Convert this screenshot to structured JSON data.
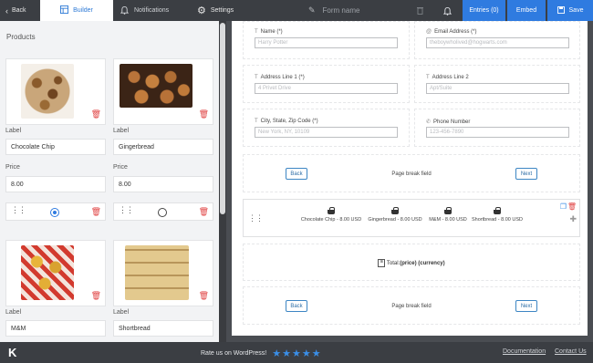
{
  "topbar": {
    "back": "Back",
    "builder": "Builder",
    "notifications": "Notifications",
    "settings": "Settings",
    "form_name": "Form name",
    "entries": "Entries (0)",
    "embed": "Embed",
    "save": "Save"
  },
  "products_panel": {
    "title": "Products",
    "label_caption": "Label",
    "price_caption": "Price",
    "products": [
      {
        "label": "Chocolate Chip",
        "price": "8.00",
        "selected": true
      },
      {
        "label": "Gingerbread",
        "price": "8.00",
        "selected": false
      },
      {
        "label": "M&M"
      },
      {
        "label": "Shortbread"
      }
    ]
  },
  "form": {
    "fields": {
      "name": {
        "label": "Name (*)",
        "placeholder": "Harry Potter"
      },
      "email": {
        "label": "Email Address (*)",
        "placeholder": "theboywholived@hogwarts.com"
      },
      "address1": {
        "label": "Address Line 1 (*)",
        "placeholder": "4 Privet Drive"
      },
      "address2": {
        "label": "Address Line 2",
        "placeholder": "Apt/Suite"
      },
      "city": {
        "label": "City, State, Zip Code (*)",
        "placeholder": "New York, NY, 10109"
      },
      "phone": {
        "label": "Phone Number",
        "placeholder": "123-456-7890"
      }
    },
    "page_break_1": {
      "back": "Back",
      "text": "Page break field",
      "next": "Next"
    },
    "product_items": [
      "Chocolate Chip - 8.00 USD",
      "Gingerbread - 8.00 USD",
      "M&M - 8.00 USD",
      "Shortbread - 8.00 USD"
    ],
    "total_label": "Total:",
    "total_expr": "(price) (currency)",
    "page_break_2": {
      "back": "Back",
      "text": "Page break field",
      "next": "Next"
    }
  },
  "bottombar": {
    "logo": "K",
    "rate_text": "Rate us on WordPress!",
    "stars": "★★★★★",
    "documentation": "Documentation",
    "contact": "Contact Us"
  },
  "colors": {
    "accent": "#2f7be0",
    "bar": "#3b3e43",
    "danger": "#e04343"
  }
}
